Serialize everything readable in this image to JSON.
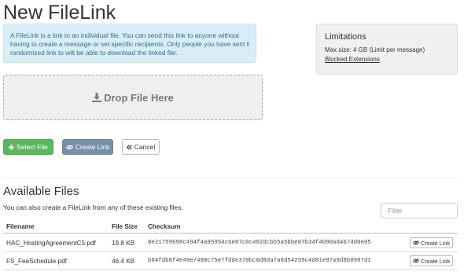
{
  "page": {
    "title": "New FileLink"
  },
  "info": {
    "lines": [
      "A FileLink is a link to an individual file. You can send this link to anyone without",
      "having to create a message or set specific recipients. Only people you have sent the",
      "randomized link to will be able to download the linked file."
    ]
  },
  "dropzone": {
    "label": "Drop File Here",
    "icon": "download-icon"
  },
  "actions": {
    "select_file": "Select File",
    "create_link": "Create Link",
    "cancel": "Cancel"
  },
  "limitations": {
    "title": "Limitations",
    "max_size": "Max size: 4 GB (Limit per message)",
    "blocked_link": "Blocked Extensions"
  },
  "available": {
    "title": "Available Files",
    "description": "You can also create a FileLink from any of these existing files.",
    "filter_placeholder": "Filter",
    "columns": {
      "filename": "Filename",
      "size": "File Size",
      "checksum": "Checksum"
    },
    "rows": [
      {
        "filename": "HAC_HostingAgreementC5.pdf",
        "size": "19.8 KB",
        "checksum": "8e21759698c494f4a95954c6e87c0c482dcbb5a5bbe07b34f4090ad4b74d0e05",
        "action": "Create Link"
      },
      {
        "filename": "FS_FeeSchedule.pdf",
        "size": "46.4 KB",
        "checksum": "b64fdb8f4e49e7490c75e7fdde370bc0d8da7a8d54239c4d81e87a9d8b0907d1",
        "action": "Create Link"
      }
    ]
  }
}
